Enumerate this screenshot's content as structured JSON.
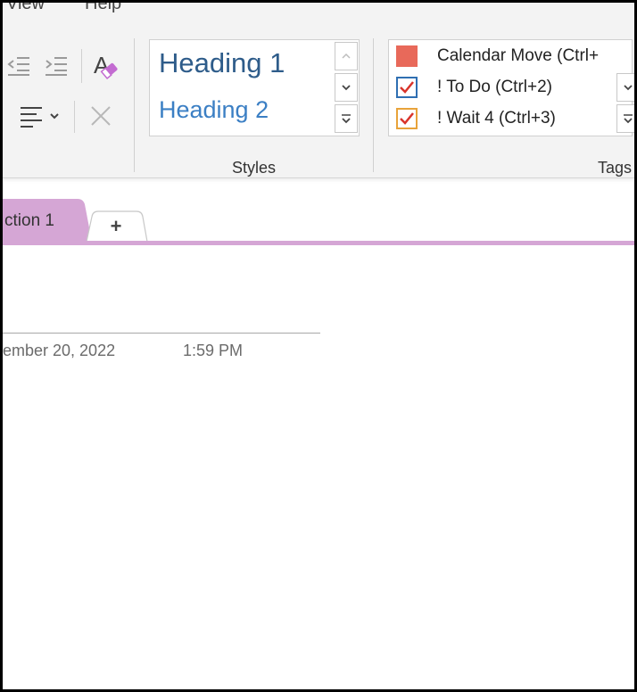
{
  "menu": {
    "view_label": "View",
    "help_label": "Help"
  },
  "ribbon": {
    "basic_text": {
      "decrease_indent_icon": "outdent-icon",
      "increase_indent_icon": "indent-icon",
      "clear_formatting_icon": "clear-formatting-icon",
      "align_icon": "align-left-icon",
      "delete_icon": "close-icon"
    },
    "styles": {
      "items": [
        "Heading 1",
        "Heading 2"
      ],
      "group_label": "Styles",
      "colors": {
        "heading1": "#2e5c8a",
        "heading2": "#3b7fc4"
      }
    },
    "tags": {
      "items": [
        {
          "label": "Calendar Move (Ctrl+",
          "icon": "red-square-icon"
        },
        {
          "label": "! To Do (Ctrl+2)",
          "icon": "checkbox-checked-icon"
        },
        {
          "label": "! Wait 4 (Ctrl+3)",
          "icon": "checkbox-checked-orange-icon"
        }
      ],
      "group_label": "Tags",
      "colors": {
        "calendar": "#e8695a",
        "todo_border": "#2f6fb2",
        "wait_border": "#e8a33a",
        "check": "#d9342b"
      }
    }
  },
  "section_tabs": {
    "active_tab": "ction 1",
    "add_tab_label": "+",
    "accent_color": "#d5a6d5"
  },
  "page": {
    "date": "ember 20, 2022",
    "time": "1:59 PM"
  }
}
